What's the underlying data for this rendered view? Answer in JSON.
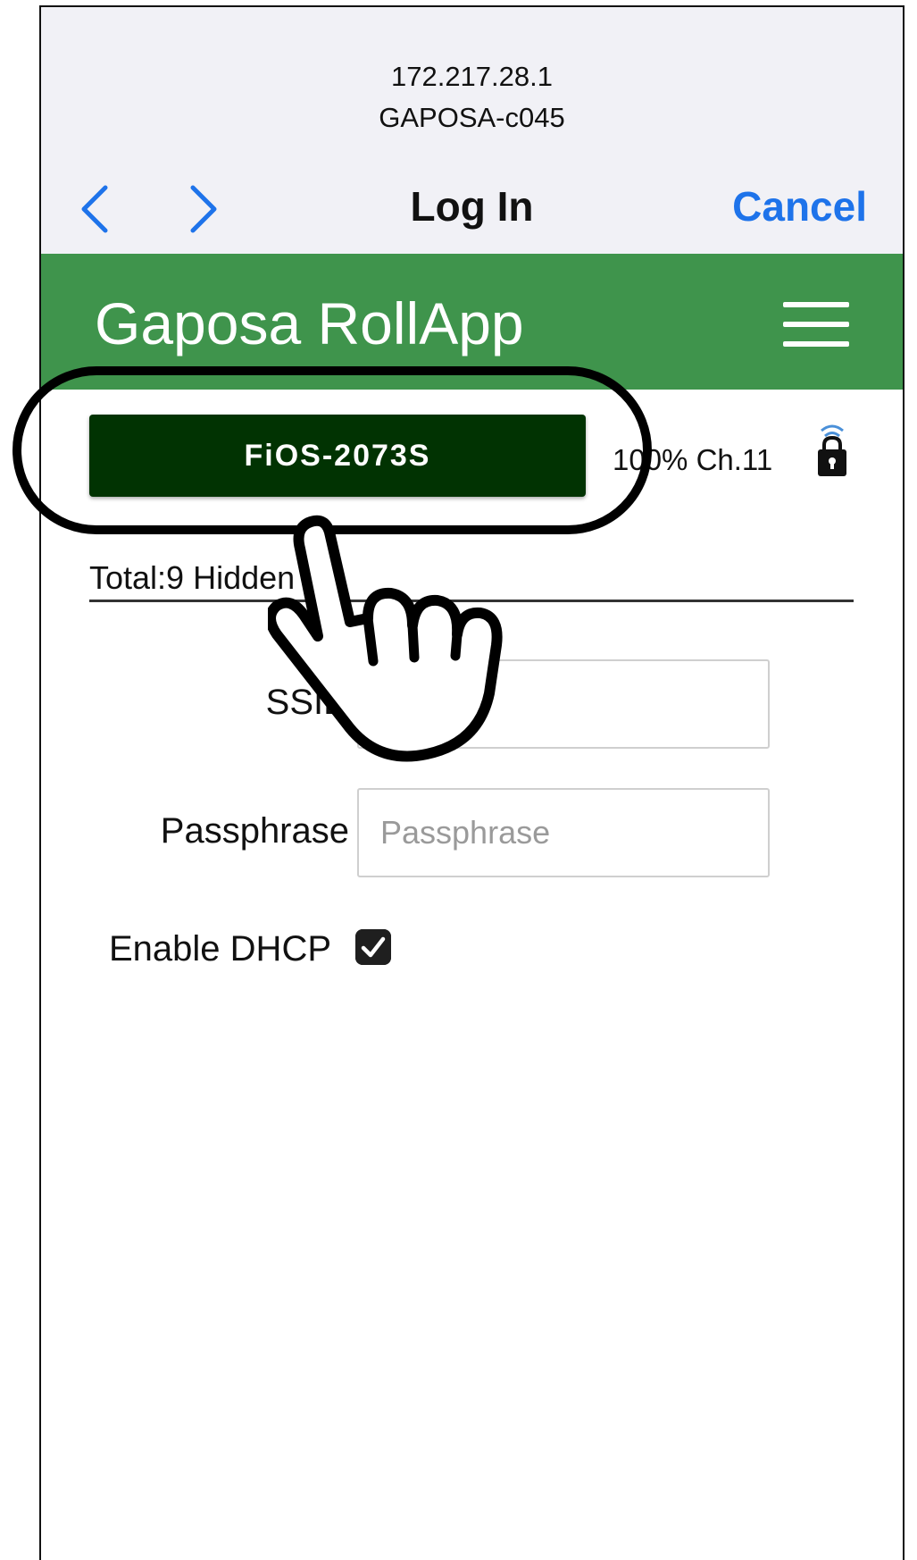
{
  "browser_bar": {
    "host_ip": "172.217.28.1",
    "host_name": "GAPOSA-c045",
    "title": "Log In",
    "cancel_label": "Cancel",
    "back_icon": "chevron-left-icon",
    "forward_icon": "chevron-right-icon"
  },
  "app_header": {
    "title": "Gaposa RollApp",
    "menu_icon": "hamburger-menu-icon",
    "color": "#3f944c"
  },
  "network": {
    "ssid_button_label": "FiOS-2073S",
    "signal_text": "100% Ch.11",
    "lock_icon": "wifi-lock-icon",
    "button_color": "#013302"
  },
  "network_list": {
    "total_label": "Total:9 Hidden"
  },
  "form": {
    "ssid_label": "SSID",
    "ssid_value": "",
    "passphrase_label": "Passphrase",
    "passphrase_placeholder": "Passphrase",
    "dhcp_label": "Enable DHCP",
    "dhcp_checked": true
  },
  "colors": {
    "link_blue": "#1e73ea"
  }
}
